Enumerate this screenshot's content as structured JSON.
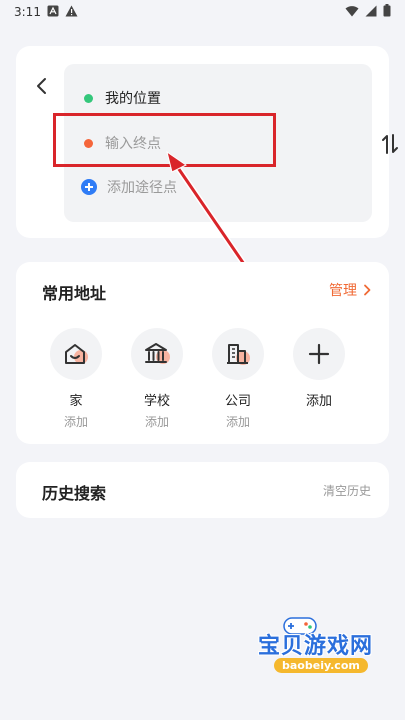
{
  "status_bar": {
    "time": "3:11"
  },
  "route": {
    "origin": "我的位置",
    "destination_placeholder": "输入终点",
    "add_via": "添加途径点"
  },
  "favorites": {
    "title": "常用地址",
    "manage": "管理",
    "items": [
      {
        "name": "家",
        "sub": "添加",
        "icon": "home-icon"
      },
      {
        "name": "学校",
        "sub": "添加",
        "icon": "school-icon"
      },
      {
        "name": "公司",
        "sub": "添加",
        "icon": "company-icon"
      },
      {
        "name": "添加",
        "icon": "plus-icon"
      }
    ]
  },
  "history": {
    "title": "历史搜索",
    "clear": "清空历史"
  },
  "watermark": {
    "title": "宝贝游戏网",
    "url": "baobeiy.com"
  },
  "colors": {
    "accent": "#f06a35",
    "origin_dot": "#34c77b",
    "destination_dot": "#f5653a",
    "via_icon": "#2f7cf6",
    "highlight": "#d9252a"
  }
}
